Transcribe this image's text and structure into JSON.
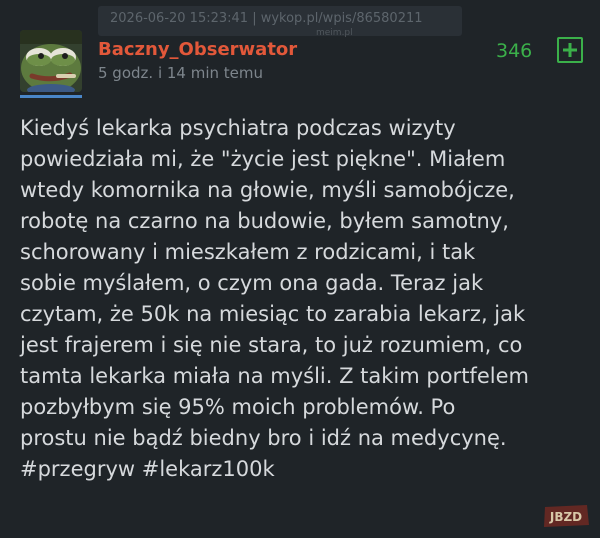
{
  "watermark": {
    "text": "2026-06-20 15:23:41 | wykop.pl/wpis/86580211",
    "sub": "meim.pl"
  },
  "post": {
    "author": "Baczny_Obserwator",
    "time_ago": "5 godz. i 14 min temu",
    "votes": "346",
    "plus_icon": "plus-icon",
    "body_lines": [
      "Kiedyś lekarka psychiatra podczas wizyty",
      "powiedziała mi, że \"życie jest piękne\". Miałem",
      "wtedy komornika na głowie, myśli samobójcze,",
      "robotę na czarno na budowie, byłem samotny,",
      "schorowany i mieszkałem z rodzicami, i tak",
      "sobie myślałem, o czym ona gada. Teraz jak",
      "czytam, że 50k na miesiąc to zarabia lekarz, jak",
      "jest frajerem i się nie stara, to już rozumiem, co",
      "tamta lekarka miała na myśli. Z takim portfelem",
      "pozbyłbym się 95% moich problemów. Po",
      "prostu nie bądź biedny bro i idź na medycynę.",
      "#przegryw #lekarz100k"
    ]
  },
  "site_logo": {
    "text": "JBZD"
  },
  "colors": {
    "background": "#1f2428",
    "author": "#e2583a",
    "votes": "#3bb04a",
    "text": "#d6d9dc",
    "muted": "#7d858c"
  }
}
